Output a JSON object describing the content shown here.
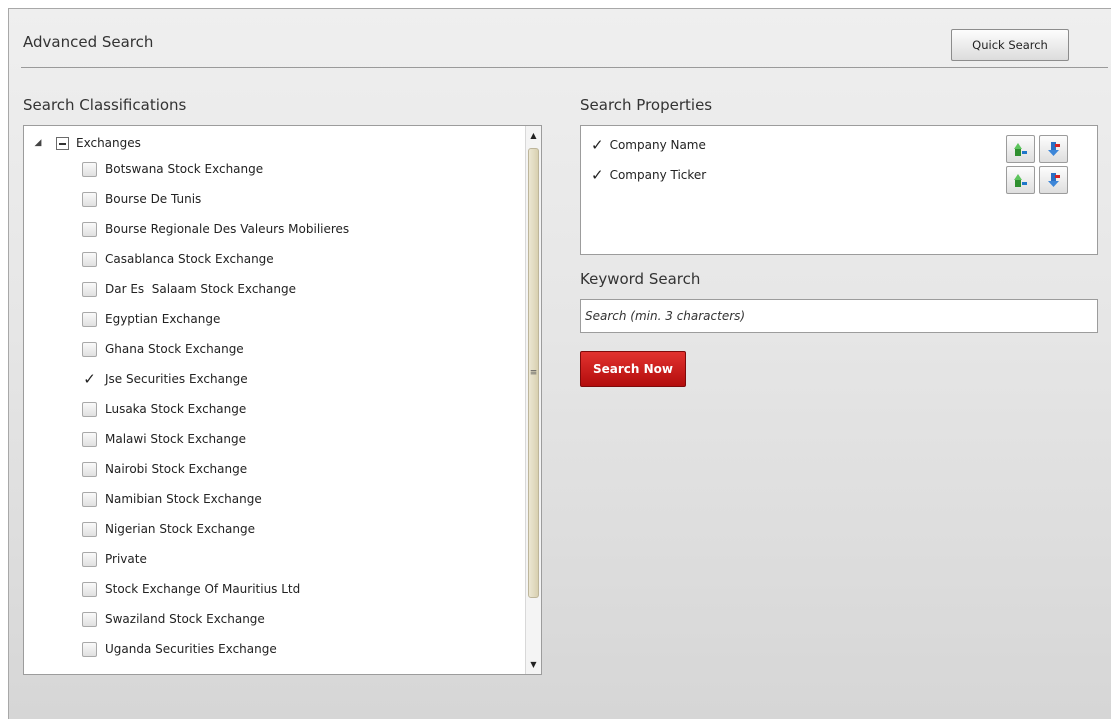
{
  "header": {
    "title": "Advanced Search",
    "quick_search_label": "Quick Search"
  },
  "classifications": {
    "label": "Search Classifications",
    "root": {
      "label": "Exchanges",
      "expanded": true,
      "state": "partial"
    },
    "items": [
      {
        "label": "Botswana Stock Exchange",
        "checked": false
      },
      {
        "label": "Bourse De Tunis",
        "checked": false
      },
      {
        "label": "Bourse Regionale Des Valeurs Mobilieres",
        "checked": false
      },
      {
        "label": "Casablanca Stock Exchange",
        "checked": false
      },
      {
        "label": "Dar Es  Salaam Stock Exchange",
        "checked": false
      },
      {
        "label": "Egyptian Exchange",
        "checked": false
      },
      {
        "label": "Ghana Stock Exchange",
        "checked": false
      },
      {
        "label": "Jse Securities Exchange",
        "checked": true
      },
      {
        "label": "Lusaka Stock Exchange",
        "checked": false
      },
      {
        "label": "Malawi Stock Exchange",
        "checked": false
      },
      {
        "label": "Nairobi Stock Exchange",
        "checked": false
      },
      {
        "label": "Namibian Stock Exchange",
        "checked": false
      },
      {
        "label": "Nigerian Stock Exchange",
        "checked": false
      },
      {
        "label": "Private",
        "checked": false
      },
      {
        "label": "Stock Exchange Of Mauritius Ltd",
        "checked": false
      },
      {
        "label": "Swaziland Stock Exchange",
        "checked": false
      },
      {
        "label": "Uganda Securities Exchange",
        "checked": false
      }
    ]
  },
  "properties": {
    "label": "Search Properties",
    "items": [
      {
        "label": "Company Name",
        "checked": true
      },
      {
        "label": "Company Ticker",
        "checked": true
      }
    ]
  },
  "keyword": {
    "label": "Keyword Search",
    "placeholder": "Search (min. 3 characters)"
  },
  "search_now_label": "Search Now",
  "colors": {
    "accent": "#c8191a",
    "panel_bg": "#e6e6e6"
  },
  "icons": {
    "move_up": "green-up-arrow-icon",
    "move_down": "red-down-arrow-icon"
  }
}
